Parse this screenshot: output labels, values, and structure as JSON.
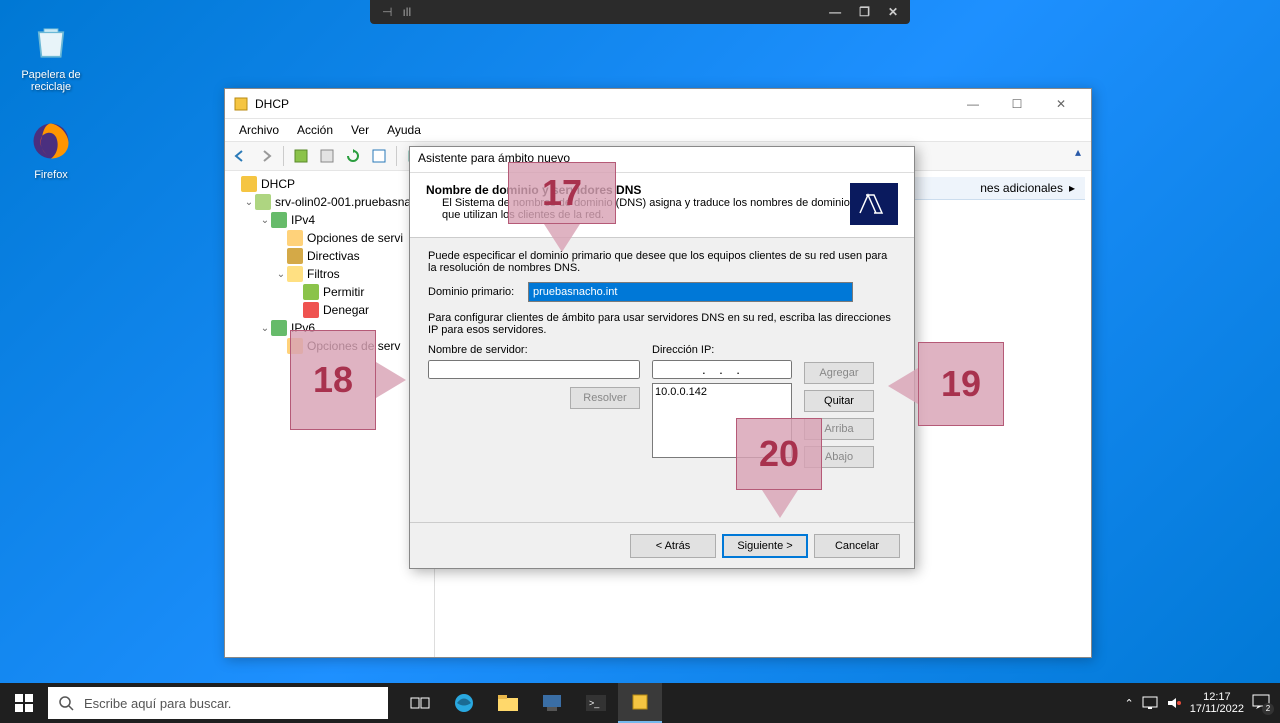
{
  "desktop": {
    "recycle_bin": "Papelera de\nreciclaje",
    "firefox": "Firefox"
  },
  "remote_bar": {
    "pin": "⊣",
    "signal": "ıll"
  },
  "dhcp_window": {
    "title": "DHCP",
    "menu": {
      "archivo": "Archivo",
      "accion": "Acción",
      "ver": "Ver",
      "ayuda": "Ayuda"
    },
    "tree": {
      "root": "DHCP",
      "server": "srv-olin02-001.pruebasna",
      "ipv4": "IPv4",
      "opciones_v4": "Opciones de servi",
      "directivas": "Directivas",
      "filtros": "Filtros",
      "permitir": "Permitir",
      "denegar": "Denegar",
      "ipv6": "IPv6",
      "opciones_v6": "Opciones de serv"
    },
    "content_header": "nes adicionales"
  },
  "wizard": {
    "title": "Asistente para ámbito nuevo",
    "header_bold": "Nombre de dominio y servidores DNS",
    "header_desc": "El Sistema de nombres de dominio (DNS) asigna y traduce los nombres de dominio que utilizan los clientes de la red.",
    "body_p1": "Puede especificar el dominio primario que desee que los equipos clientes de su red usen para la resolución de nombres DNS.",
    "domain_label": "Dominio primario:",
    "domain_value": "pruebasnacho.int",
    "body_p2": "Para configurar clientes de ámbito para usar servidores DNS en su red, escriba las direcciones IP para esos servidores.",
    "server_name_label": "Nombre de servidor:",
    "ip_label": "Dirección IP:",
    "ip_listed": "10.0.0.142",
    "btn_resolver": "Resolver",
    "btn_agregar": "Agregar",
    "btn_quitar": "Quitar",
    "btn_arriba": "Arriba",
    "btn_abajo": "Abajo",
    "btn_atras": "< Atrás",
    "btn_siguiente": "Siguiente >",
    "btn_cancelar": "Cancelar"
  },
  "callouts": {
    "c17": "17",
    "c18": "18",
    "c19": "19",
    "c20": "20"
  },
  "taskbar": {
    "search_placeholder": "Escribe aquí para buscar.",
    "time": "12:17",
    "date": "17/11/2022",
    "notif_count": "2"
  }
}
